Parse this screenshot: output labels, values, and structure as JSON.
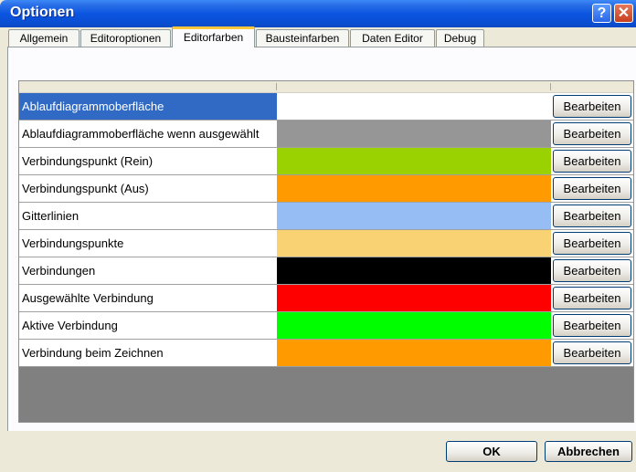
{
  "window": {
    "title": "Optionen"
  },
  "titlebar": {
    "help_glyph": "?",
    "close_glyph": "✕"
  },
  "tabs": [
    {
      "label": "Allgemein",
      "active": false
    },
    {
      "label": "Editoroptionen",
      "active": false
    },
    {
      "label": "Editorfarben",
      "active": true
    },
    {
      "label": "Bausteinfarben",
      "active": false
    },
    {
      "label": "Daten Editor",
      "active": false
    },
    {
      "label": "Debug",
      "active": false
    }
  ],
  "color_rows": [
    {
      "label": "Ablaufdiagrammoberfläche",
      "color": "#ffffff",
      "button": "Bearbeiten",
      "selected": true
    },
    {
      "label": "Ablaufdiagrammoberfläche wenn ausgewählt",
      "color": "#969696",
      "button": "Bearbeiten",
      "selected": false
    },
    {
      "label": "Verbindungspunkt (Rein)",
      "color": "#99d200",
      "button": "Bearbeiten",
      "selected": false
    },
    {
      "label": "Verbindungspunkt (Aus)",
      "color": "#ff9a00",
      "button": "Bearbeiten",
      "selected": false
    },
    {
      "label": "Gitterlinien",
      "color": "#96bef5",
      "button": "Bearbeiten",
      "selected": false
    },
    {
      "label": "Verbindungspunkte",
      "color": "#f9d273",
      "button": "Bearbeiten",
      "selected": false
    },
    {
      "label": "Verbindungen",
      "color": "#000000",
      "button": "Bearbeiten",
      "selected": false
    },
    {
      "label": "Ausgewählte Verbindung",
      "color": "#fe0000",
      "button": "Bearbeiten",
      "selected": false
    },
    {
      "label": "Aktive Verbindung",
      "color": "#00fe00",
      "button": "Bearbeiten",
      "selected": false
    },
    {
      "label": "Verbindung beim Zeichnen",
      "color": "#ff9a00",
      "button": "Bearbeiten",
      "selected": false
    }
  ],
  "footer": {
    "ok_label": "OK",
    "cancel_label": "Abbrechen"
  },
  "colors": {
    "titlebar_blue": "#0b55e0",
    "selection_blue": "#316ac5",
    "dialog_bg": "#ece9d8",
    "grid_empty": "#808080"
  }
}
